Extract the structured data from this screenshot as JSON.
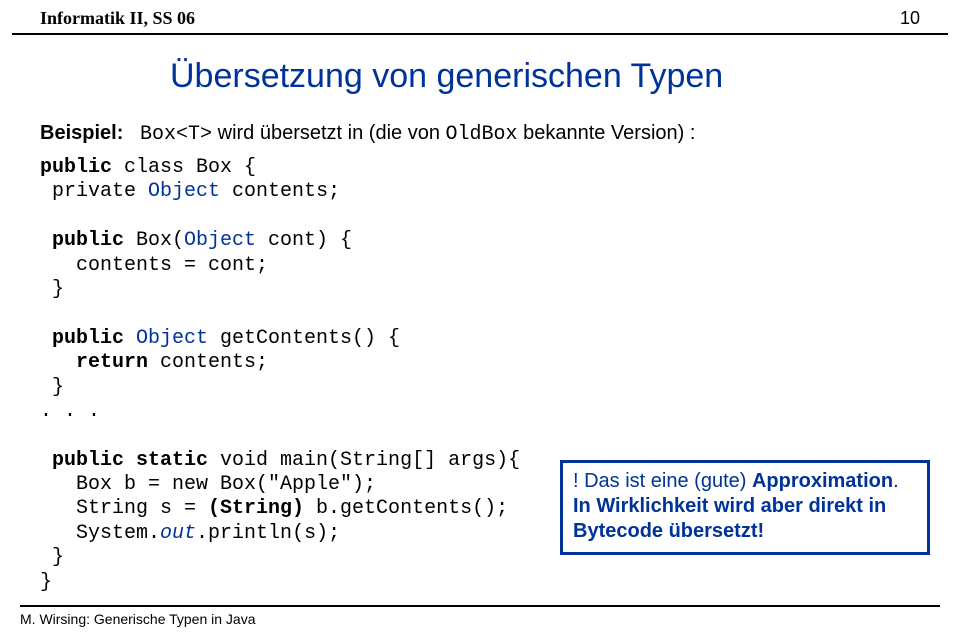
{
  "header": {
    "left": "Informatik II, SS 06",
    "right": "10"
  },
  "title": "Übersetzung von generischen Typen",
  "intro": {
    "label": "Beispiel:",
    "before": "Box<T>",
    "mid1": " wird übersetzt in (die von ",
    "mono2": "OldBox",
    "after": " bekannte Version) :"
  },
  "code": {
    "l1a": "public",
    "l1b": " class Box {",
    "l2a": " private ",
    "l2b": "Object",
    "l2c": " contents;",
    "l3": "",
    "l4a": " public",
    "l4b": " Box(",
    "l4c": "Object",
    "l4d": " cont) {",
    "l5": "   contents = cont;",
    "l6": " }",
    "l7": "",
    "l8a": " public ",
    "l8b": "Object",
    "l8c": " getContents() {",
    "l9a": "   return",
    "l9b": " contents;",
    "l10": " }",
    "l11": ". . .",
    "l12": "",
    "l13a": " public static",
    "l13b": " void main(String[] args){",
    "l14": "   Box b = new Box(\"Apple\");",
    "l15a": "   String s = ",
    "l15b": "(String)",
    "l15c": " b.getContents();",
    "l16a": "   System.",
    "l16b": "out",
    "l16c": ".println(s);",
    "l17": " }",
    "l18": "}"
  },
  "callout": {
    "line1a": "! Das ist eine (gute) ",
    "line1b": "Approximation",
    "line1c": ".",
    "line2": "In Wirklichkeit wird aber direkt in Bytecode übersetzt!"
  },
  "footer": {
    "author": "M. Wirsing: ",
    "rest": "Generische Typen in Java"
  }
}
